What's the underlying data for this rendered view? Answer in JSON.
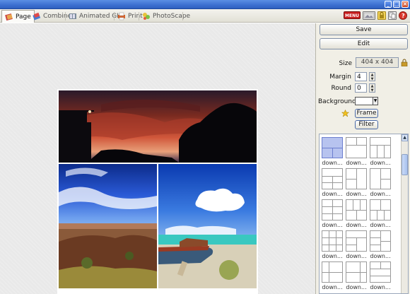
{
  "window": {
    "controls": [
      "minimize",
      "maximize",
      "close"
    ]
  },
  "tabs": [
    {
      "label": "Page",
      "icon": "page-icon",
      "active": true
    },
    {
      "label": "Combine",
      "icon": "combine-icon",
      "active": false
    },
    {
      "label": "Animated GIF",
      "icon": "animated-gif-icon",
      "active": false
    },
    {
      "label": "Print",
      "icon": "print-icon",
      "active": false
    },
    {
      "label": "PhotoScape",
      "icon": "photoscape-icon",
      "active": false
    }
  ],
  "toolbar": {
    "menu_label": "MENU"
  },
  "panel": {
    "save_label": "Save",
    "edit_label": "Edit",
    "size_label": "Size",
    "size_value": "404 x 404",
    "margin_label": "Margin",
    "margin_value": "4",
    "round_label": "Round",
    "round_value": "0",
    "background_label": "Background",
    "background_color": "#ffffff",
    "frame_label": "Frame",
    "filter_label": "Filter"
  },
  "templates": [
    {
      "caption": "down...",
      "selected": true
    },
    {
      "caption": "down..."
    },
    {
      "caption": "down..."
    },
    {
      "caption": "down..."
    },
    {
      "caption": "down..."
    },
    {
      "caption": "down..."
    },
    {
      "caption": "down..."
    },
    {
      "caption": "down..."
    },
    {
      "caption": "down..."
    },
    {
      "caption": "down..."
    },
    {
      "caption": "down..."
    },
    {
      "caption": "down..."
    },
    {
      "caption": "down..."
    },
    {
      "caption": "down..."
    },
    {
      "caption": "down..."
    }
  ],
  "colors": {
    "accent": "#3c6fd0",
    "selected_template": "#b7c3ef",
    "menu": "#c91f1f"
  }
}
